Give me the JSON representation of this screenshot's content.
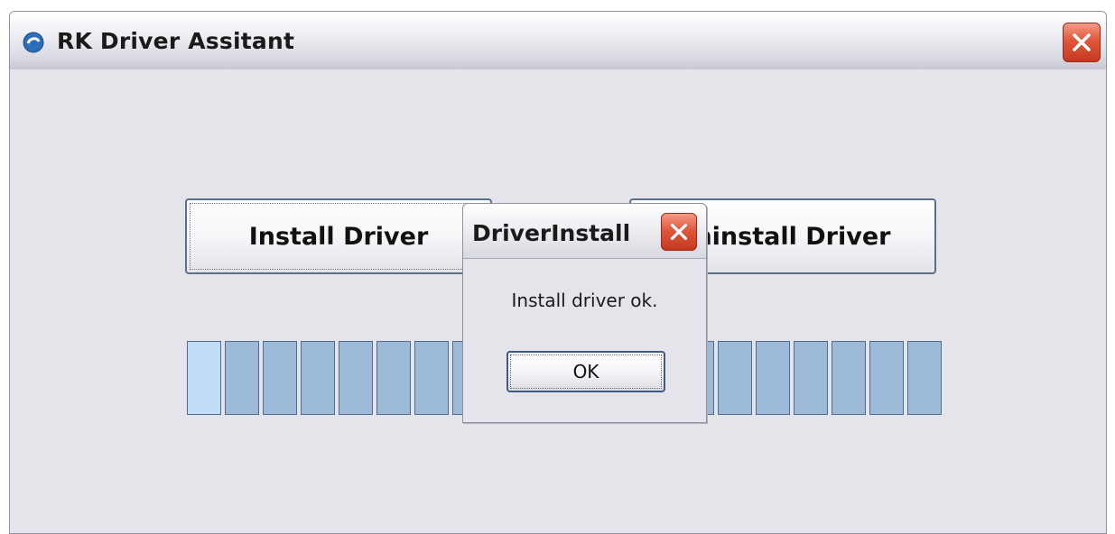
{
  "window": {
    "title": "RK Driver Assitant"
  },
  "buttons": {
    "install_label": "Install Driver",
    "uninstall_label": "Uninstall Driver"
  },
  "progress": {
    "segments_total": 20,
    "active_index": 0
  },
  "dialog": {
    "title": "DriverInstall",
    "message": "Install driver ok.",
    "ok_label": "OK"
  },
  "colors": {
    "close_button": "#e0573c",
    "progress_segment": "#9dbad8",
    "progress_segment_active": "#c1dcf5"
  },
  "icons": {
    "app_icon": "app-logo-icon",
    "close_icon": "close-icon"
  }
}
